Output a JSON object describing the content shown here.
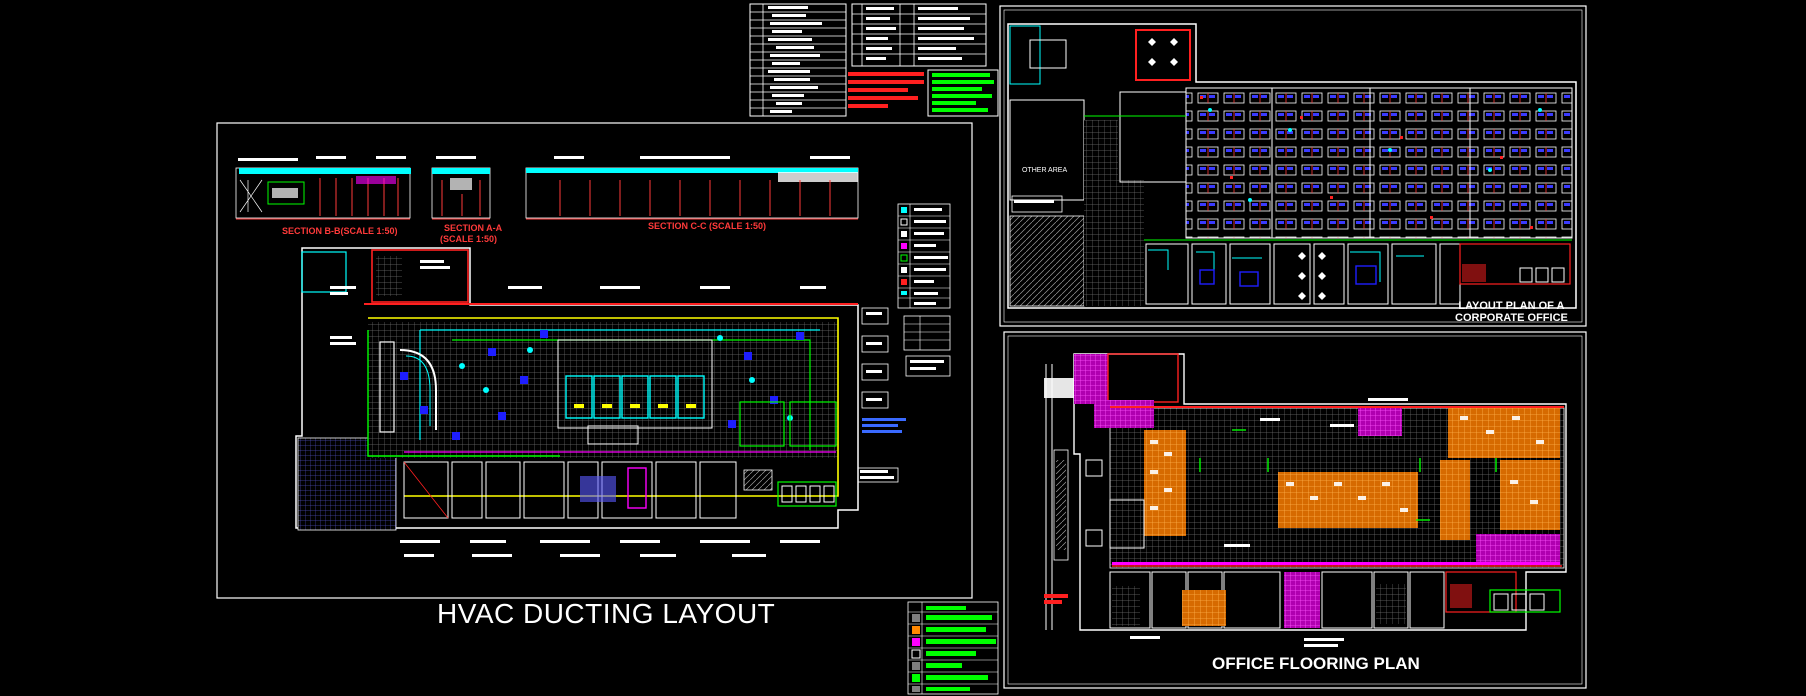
{
  "canvas": {
    "background": "#000000"
  },
  "colors": {
    "frame": "#ffffff",
    "wall": "#ffffff",
    "duct_red": "#ff0000",
    "duct_cyan": "#00ffff",
    "duct_green": "#00ff00",
    "duct_yellow": "#ffff00",
    "duct_blue": "#0000ff",
    "magenta": "#ff00ff",
    "orange": "#ff8800",
    "grid": "#7f7f7f"
  },
  "drawings": {
    "hvac": {
      "title": "HVAC DUCTING LAYOUT",
      "sections": {
        "section_b": "SECTION B-B(SCALE 1:50)",
        "section_a_line1": "SECTION A-A",
        "section_a_line2": "(SCALE 1:50)",
        "section_c": "SECTION C-C (SCALE 1:50)"
      }
    },
    "corporate": {
      "title_line1": "LAYOUT PLAN OF A",
      "title_line2": "CORPORATE OFFICE",
      "room_label": "OTHER AREA"
    },
    "flooring": {
      "title": "OFFICE FLOORING PLAN"
    }
  }
}
